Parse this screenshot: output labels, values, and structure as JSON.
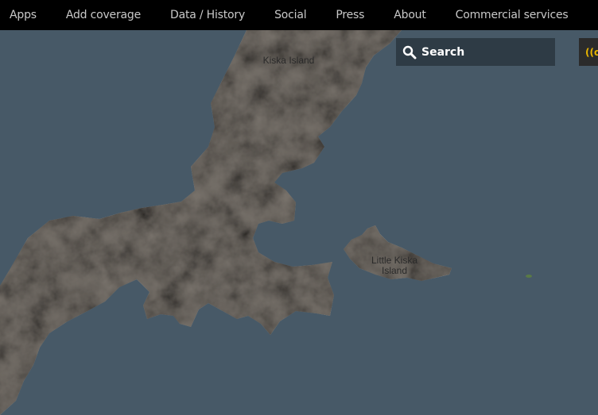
{
  "nav": {
    "items": [
      {
        "label": "Apps"
      },
      {
        "label": "Add coverage"
      },
      {
        "label": "Data / History"
      },
      {
        "label": "Social"
      },
      {
        "label": "Press"
      },
      {
        "label": "About"
      },
      {
        "label": "Commercial services"
      }
    ]
  },
  "map": {
    "water_color": "#475967",
    "land_color": "#7a746d",
    "labels": {
      "kiska": "Kiska Island",
      "little_kiska_line1": "Little Kiska",
      "little_kiska_line2": "Island"
    }
  },
  "search": {
    "label": "Search",
    "icon": "search-icon"
  },
  "live_button": {
    "label": "((o",
    "icon": "broadcast-icon",
    "color": "#e8b400"
  }
}
